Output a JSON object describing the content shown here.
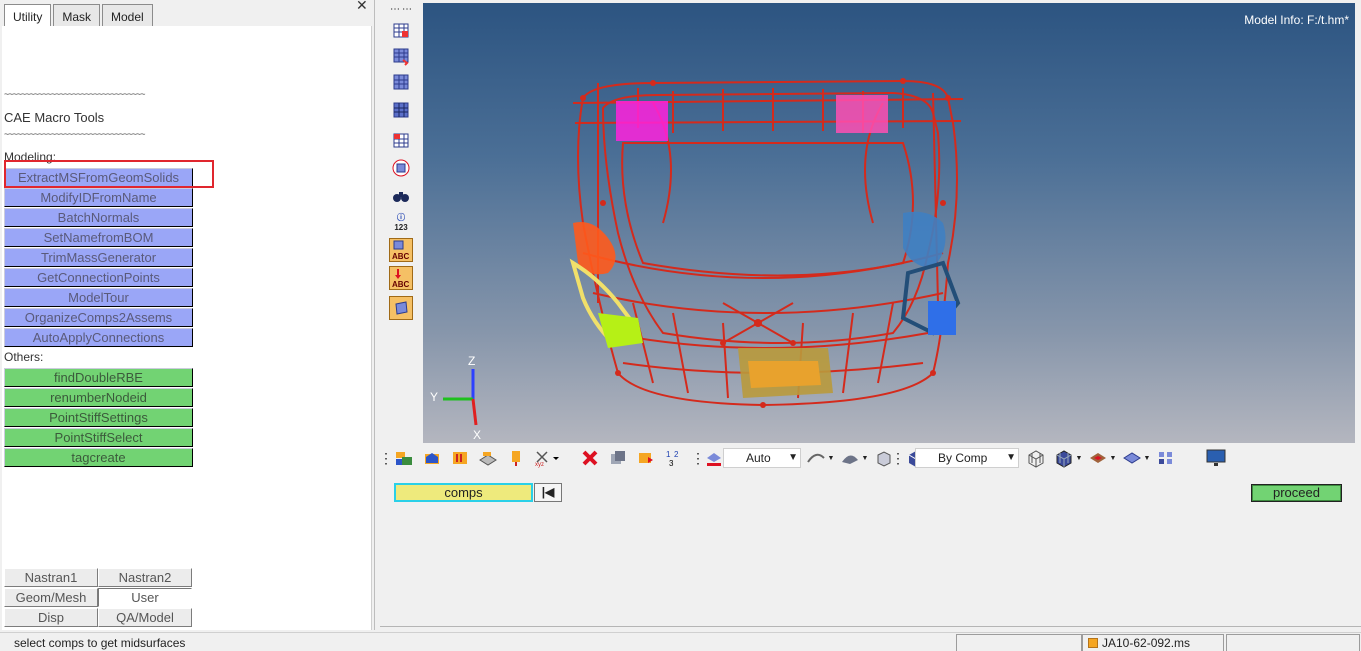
{
  "tabs": [
    "Utility",
    "Mask",
    "Model"
  ],
  "panel": {
    "separator": "~~~~~~~~~~~~~~~~~~~~~~~~~~~~~~~~~",
    "title": "CAE Macro Tools",
    "modeling_label": "Modeling:",
    "others_label": "Others:",
    "modeling_buttons": [
      "ExtractMSFromGeomSolids",
      "ModifyIDFromName",
      "BatchNormals",
      "SetNamefromBOM",
      "TrimMassGenerator",
      "GetConnectionPoints",
      "ModelTour",
      "OrganizeComps2Assems",
      "AutoApplyConnections"
    ],
    "other_buttons": [
      "findDoubleRBE",
      "renumberNodeid",
      "PointStiffSettings",
      "PointStiffSelect",
      "tagcreate"
    ]
  },
  "page_buttons": {
    "row1": [
      "Nastran1",
      "Nastran2"
    ],
    "row2": [
      "Geom/Mesh",
      "User"
    ],
    "row3": [
      "Disp",
      "QA/Model"
    ]
  },
  "viewport": {
    "model_info": "Model Info: F:/t.hm*",
    "triad": {
      "z": "Z",
      "y": "Y",
      "x": "X"
    }
  },
  "toolbar": {
    "numbering_glyph": "123",
    "display_mode": "Auto",
    "color_mode": "By Comp",
    "abc_label": "ABC"
  },
  "selector": {
    "comps_label": "comps",
    "proceed_label": "proceed"
  },
  "status": {
    "message": "select comps to get midsurfaces",
    "file": "JA10-62-092.ms"
  },
  "colors": {
    "modeling_button": "#9aa6f7",
    "other_button": "#72d373",
    "mesh_red": "#d42a1c",
    "highlight": "#e0262e"
  }
}
